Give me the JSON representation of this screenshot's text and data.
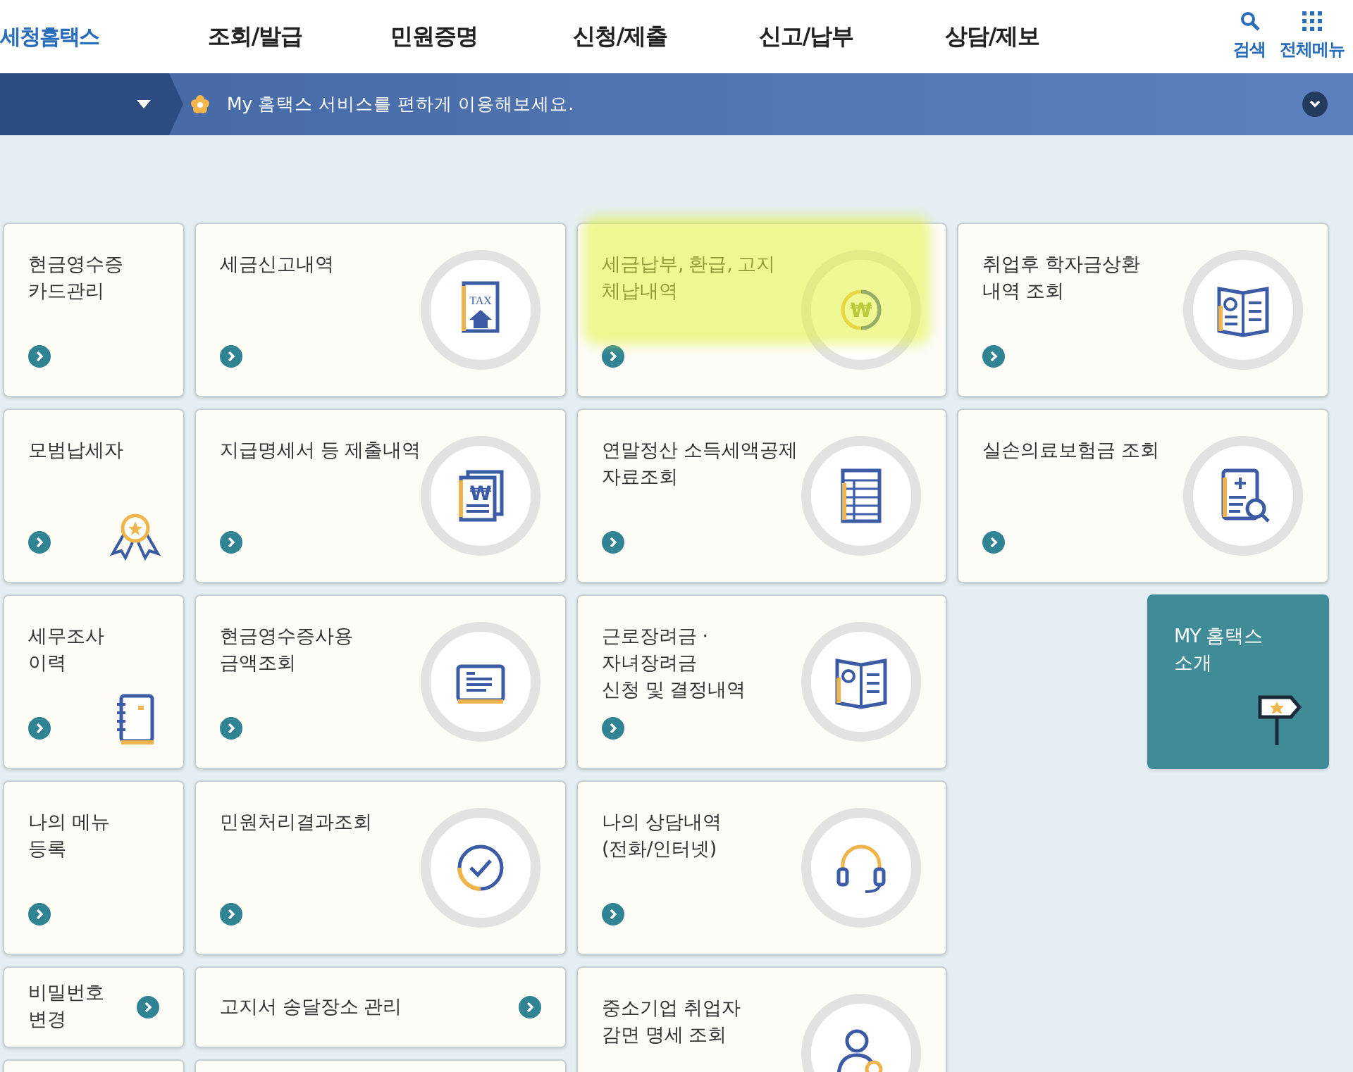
{
  "header": {
    "logo": "세청홈택스",
    "nav": [
      "조회/발급",
      "민원증명",
      "신청/제출",
      "신고/납부",
      "상담/제보"
    ],
    "search_label": "검색",
    "all_menu_label": "전체메뉴"
  },
  "banner": {
    "message": "My 홈택스 서비스를 편하게 이용해보세요."
  },
  "tiles": [
    {
      "kind": "narrow",
      "label": "현금영수증\n카드관리"
    },
    {
      "kind": "wide",
      "label": "세금신고내역",
      "icon_label": "TAX"
    },
    {
      "kind": "wide",
      "label": "세금납부, 환급, 고지\n체납내역",
      "icon_label": "₩",
      "highlighted": true
    },
    {
      "kind": "wide",
      "label": "취업후 학자금상환\n내역 조회"
    },
    {
      "kind": "narrow",
      "label": "모범납세자"
    },
    {
      "kind": "wide",
      "label": "지급명세서 등 제출내역",
      "icon_label": "₩"
    },
    {
      "kind": "wide",
      "label": "연말정산 소득세액공제\n자료조회"
    },
    {
      "kind": "wide",
      "label": "실손의료보험금 조회"
    },
    {
      "kind": "narrow",
      "label": "세무조사\n이력"
    },
    {
      "kind": "wide",
      "label": "현금영수증사용\n금액조회"
    },
    {
      "kind": "wide",
      "label": "근로장려금 ·\n자녀장려금\n신청 및 결정내역"
    },
    {
      "kind": "promo",
      "label": "MY 홈택스\n소개"
    },
    {
      "kind": "narrow",
      "label": "나의 메뉴\n등록"
    },
    {
      "kind": "wide",
      "label": "민원처리결과조회"
    },
    {
      "kind": "wide",
      "label": "나의 상담내역\n(전화/인터넷)"
    },
    {
      "kind": "narrow-short",
      "label": "비밀번호\n변경"
    },
    {
      "kind": "wide-short",
      "label": "고지서 송달장소 관리"
    },
    {
      "kind": "wide-tall",
      "label": "중소기업 취업자\n감면 명세 조회"
    },
    {
      "kind": "narrow-stub"
    },
    {
      "kind": "wide-stub"
    }
  ]
}
